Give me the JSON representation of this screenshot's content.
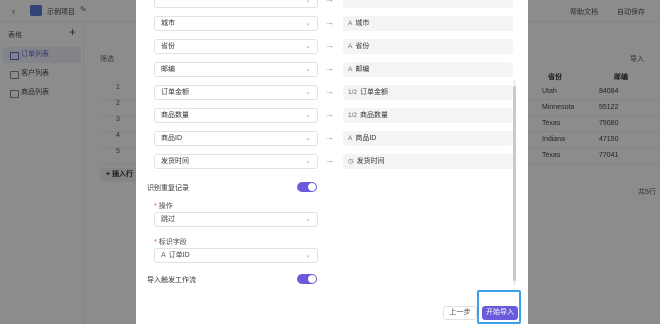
{
  "topbar": {
    "project_name": "示例项目",
    "help_label": "帮助文档",
    "save_label": "自动保存"
  },
  "sidebar": {
    "header": "表格",
    "items": [
      {
        "label": "订单列表",
        "active": true
      },
      {
        "label": "客户列表",
        "active": false
      },
      {
        "label": "商品列表",
        "active": false
      }
    ]
  },
  "main": {
    "filter_label": "筛选",
    "import_label": "导入",
    "columns": {
      "state": "省份",
      "zip": "邮编"
    },
    "row_numbers": [
      "1",
      "2",
      "3",
      "4",
      "5"
    ],
    "rows": [
      {
        "state": "Utah",
        "zip": "84084"
      },
      {
        "state": "Minnesota",
        "zip": "55122"
      },
      {
        "state": "Texas",
        "zip": "75080"
      },
      {
        "state": "Indiana",
        "zip": "47150"
      },
      {
        "state": "Texas",
        "zip": "77041"
      }
    ],
    "add_row_label": "+ 插入行",
    "rows_total": "共5行"
  },
  "modal": {
    "mappings": [
      {
        "source": "城市",
        "target_icon": "text-icon",
        "target": "城市"
      },
      {
        "source": "省份",
        "target_icon": "text-icon",
        "target": "省份"
      },
      {
        "source": "邮编",
        "target_icon": "text-icon",
        "target": "邮编"
      },
      {
        "source": "订单金额",
        "target_icon": "number-icon",
        "target": "订单金额"
      },
      {
        "source": "商品数量",
        "target_icon": "number-icon",
        "target": "商品数量"
      },
      {
        "source": "商品ID",
        "target_icon": "text-icon",
        "target": "商品ID"
      },
      {
        "source": "发货时间",
        "target_icon": "clock-icon",
        "target": "发货时间"
      }
    ],
    "dedupe_label": "识别重复记录",
    "dedupe_on": true,
    "operation_label": "操作",
    "operation_value": "跳过",
    "key_field_label": "标识字段",
    "key_field_value": "订单ID",
    "trigger_label": "导入触发工作流",
    "trigger_on": true,
    "prev_button": "上一步",
    "start_button": "开始导入"
  },
  "colors": {
    "accent": "#6a5bdc",
    "highlight_frame": "#3aa0e8"
  }
}
